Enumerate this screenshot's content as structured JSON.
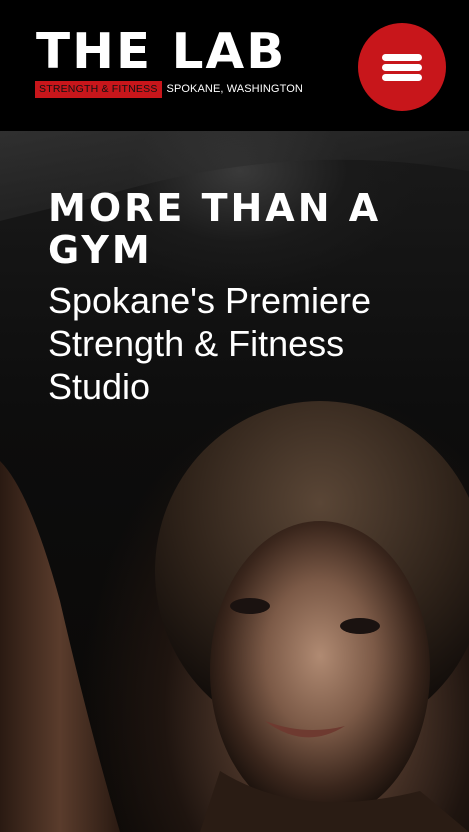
{
  "header": {
    "logo": {
      "title": "THE LAB",
      "tagline": "STRENGTH & FITNESS",
      "location": "SPOKANE, WASHINGTON"
    },
    "menu_icon": "hamburger-menu-icon"
  },
  "hero": {
    "title": "MORE THAN A GYM",
    "subtitle": "Spokane's Premiere Strength & Fitness Studio"
  },
  "colors": {
    "brand_red": "#c8161b",
    "header_bg": "#000000",
    "text": "#ffffff"
  }
}
